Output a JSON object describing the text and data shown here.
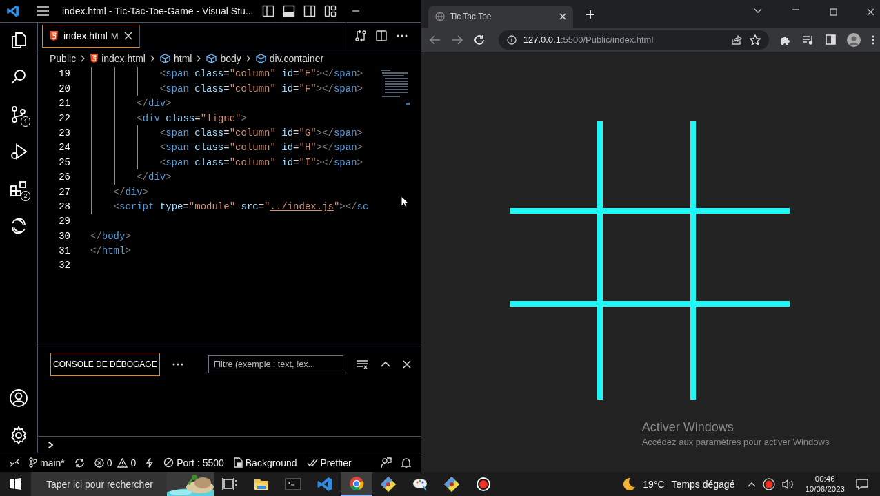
{
  "vscode": {
    "title": "index.html - Tic-Tac-Toe-Game - Visual Stu...",
    "activity_bar": [
      {
        "kind": "explorer"
      },
      {
        "kind": "search"
      },
      {
        "kind": "source-control",
        "badge": "1"
      },
      {
        "kind": "run-debug"
      },
      {
        "kind": "extensions",
        "badge": "2"
      },
      {
        "kind": "assistant"
      }
    ],
    "activity_bottom": [
      {
        "kind": "account"
      },
      {
        "kind": "settings"
      }
    ],
    "editor_tab": {
      "label": "index.html",
      "status": "M"
    },
    "breadcrumb": [
      {
        "kind": "folder",
        "label": "Public"
      },
      {
        "kind": "file",
        "label": "index.html"
      },
      {
        "kind": "element",
        "label": "html"
      },
      {
        "kind": "element",
        "label": "body"
      },
      {
        "kind": "element",
        "label": "div.container"
      }
    ],
    "code_lines": [
      {
        "number": "19",
        "tokens": [
          {
            "kind": "bracket",
            "text": "            <"
          },
          {
            "kind": "tag",
            "text": "span"
          },
          {
            "kind": "attr",
            "text": " class"
          },
          {
            "kind": "plain",
            "text": "="
          },
          {
            "kind": "string",
            "text": "\"column\""
          },
          {
            "kind": "attr",
            "text": " id"
          },
          {
            "kind": "plain",
            "text": "="
          },
          {
            "kind": "string",
            "text": "\"E\""
          },
          {
            "kind": "bracket",
            "text": "></"
          },
          {
            "kind": "tag",
            "text": "span"
          },
          {
            "kind": "bracket",
            "text": ">"
          }
        ]
      },
      {
        "number": "20",
        "tokens": [
          {
            "kind": "bracket",
            "text": "            <"
          },
          {
            "kind": "tag",
            "text": "span"
          },
          {
            "kind": "attr",
            "text": " class"
          },
          {
            "kind": "plain",
            "text": "="
          },
          {
            "kind": "string",
            "text": "\"column\""
          },
          {
            "kind": "attr",
            "text": " id"
          },
          {
            "kind": "plain",
            "text": "="
          },
          {
            "kind": "string",
            "text": "\"F\""
          },
          {
            "kind": "bracket",
            "text": "></"
          },
          {
            "kind": "tag",
            "text": "span"
          },
          {
            "kind": "bracket",
            "text": ">"
          }
        ]
      },
      {
        "number": "21",
        "tokens": [
          {
            "kind": "bracket",
            "text": "        </"
          },
          {
            "kind": "tag",
            "text": "div"
          },
          {
            "kind": "bracket",
            "text": ">"
          }
        ]
      },
      {
        "number": "22",
        "tokens": [
          {
            "kind": "bracket",
            "text": "        <"
          },
          {
            "kind": "tag",
            "text": "div"
          },
          {
            "kind": "attr",
            "text": " class"
          },
          {
            "kind": "plain",
            "text": "="
          },
          {
            "kind": "string",
            "text": "\"ligne\""
          },
          {
            "kind": "bracket",
            "text": ">"
          }
        ]
      },
      {
        "number": "23",
        "tokens": [
          {
            "kind": "bracket",
            "text": "            <"
          },
          {
            "kind": "tag",
            "text": "span"
          },
          {
            "kind": "attr",
            "text": " class"
          },
          {
            "kind": "plain",
            "text": "="
          },
          {
            "kind": "string",
            "text": "\"column\""
          },
          {
            "kind": "attr",
            "text": " id"
          },
          {
            "kind": "plain",
            "text": "="
          },
          {
            "kind": "string",
            "text": "\"G\""
          },
          {
            "kind": "bracket",
            "text": "></"
          },
          {
            "kind": "tag",
            "text": "span"
          },
          {
            "kind": "bracket",
            "text": ">"
          }
        ]
      },
      {
        "number": "24",
        "tokens": [
          {
            "kind": "bracket",
            "text": "            <"
          },
          {
            "kind": "tag",
            "text": "span"
          },
          {
            "kind": "attr",
            "text": " class"
          },
          {
            "kind": "plain",
            "text": "="
          },
          {
            "kind": "string",
            "text": "\"column\""
          },
          {
            "kind": "attr",
            "text": " id"
          },
          {
            "kind": "plain",
            "text": "="
          },
          {
            "kind": "string",
            "text": "\"H\""
          },
          {
            "kind": "bracket",
            "text": "></"
          },
          {
            "kind": "tag",
            "text": "span"
          },
          {
            "kind": "bracket",
            "text": ">"
          }
        ]
      },
      {
        "number": "25",
        "tokens": [
          {
            "kind": "bracket",
            "text": "            <"
          },
          {
            "kind": "tag",
            "text": "span"
          },
          {
            "kind": "attr",
            "text": " class"
          },
          {
            "kind": "plain",
            "text": "="
          },
          {
            "kind": "string",
            "text": "\"column\""
          },
          {
            "kind": "attr",
            "text": " id"
          },
          {
            "kind": "plain",
            "text": "="
          },
          {
            "kind": "string",
            "text": "\"I\""
          },
          {
            "kind": "bracket",
            "text": "></"
          },
          {
            "kind": "tag",
            "text": "span"
          },
          {
            "kind": "bracket",
            "text": ">"
          }
        ]
      },
      {
        "number": "26",
        "tokens": [
          {
            "kind": "bracket",
            "text": "        </"
          },
          {
            "kind": "tag",
            "text": "div"
          },
          {
            "kind": "bracket",
            "text": ">"
          }
        ]
      },
      {
        "number": "27",
        "tokens": [
          {
            "kind": "bracket",
            "text": "    </"
          },
          {
            "kind": "tag",
            "text": "div"
          },
          {
            "kind": "bracket",
            "text": ">"
          }
        ]
      },
      {
        "number": "28",
        "tokens": [
          {
            "kind": "bracket",
            "text": "    <"
          },
          {
            "kind": "tag",
            "text": "script"
          },
          {
            "kind": "attr",
            "text": " type"
          },
          {
            "kind": "plain",
            "text": "="
          },
          {
            "kind": "string",
            "text": "\"module\""
          },
          {
            "kind": "attr",
            "text": " src"
          },
          {
            "kind": "plain",
            "text": "="
          },
          {
            "kind": "string",
            "text": "\""
          },
          {
            "kind": "link",
            "text": "../index.js"
          },
          {
            "kind": "string",
            "text": "\""
          },
          {
            "kind": "bracket",
            "text": "></"
          },
          {
            "kind": "tag",
            "text": "sc"
          }
        ]
      },
      {
        "number": "29"
      },
      {
        "number": "30",
        "tokens": [
          {
            "kind": "bracket",
            "text": "</"
          },
          {
            "kind": "tag",
            "text": "body"
          },
          {
            "kind": "bracket",
            "text": ">"
          }
        ]
      },
      {
        "number": "31",
        "tokens": [
          {
            "kind": "bracket",
            "text": "</"
          },
          {
            "kind": "tag",
            "text": "html"
          },
          {
            "kind": "bracket",
            "text": ">"
          }
        ]
      },
      {
        "number": "32"
      }
    ],
    "panel": {
      "tab": "CONSOLE DE DÉBOGAGE",
      "filter_placeholder": "Filtre (exemple : text, !ex..."
    },
    "status_bar": [
      {
        "kind": "remote"
      },
      {
        "kind": "branch",
        "label": "main*"
      },
      {
        "kind": "sync"
      },
      {
        "kind": "problems",
        "errors": "0",
        "warnings": "0"
      },
      {
        "kind": "bolt"
      },
      {
        "kind": "port",
        "label": "Port : 5500"
      },
      {
        "kind": "background",
        "label": "Background"
      },
      {
        "kind": "prettier",
        "label": "Prettier"
      },
      {
        "kind": "feedback"
      },
      {
        "kind": "bell"
      }
    ]
  },
  "browser": {
    "tab_title": "Tic Tac Toe",
    "url_host": "127.0.0.1",
    "url_rest": ":5500/Public/index.html",
    "activation_notice": {
      "title": "Activer Windows",
      "text": "Accédez aux paramètres pour activer Windows"
    }
  },
  "taskbar": {
    "search_placeholder": "Taper ici pour rechercher",
    "apps": [
      {
        "kind": "task-view",
        "selected": false
      },
      {
        "kind": "explorer",
        "selected": false
      },
      {
        "kind": "terminal",
        "selected": false
      },
      {
        "kind": "vscode",
        "selected": false
      },
      {
        "kind": "chrome",
        "selected": true
      },
      {
        "kind": "git",
        "selected": false
      },
      {
        "kind": "paint",
        "selected": false
      },
      {
        "kind": "git",
        "selected": false
      },
      {
        "kind": "recorder",
        "selected": false
      }
    ],
    "weather": {
      "temp": "19°C",
      "text": "Temps dégagé"
    },
    "time": "00:46",
    "date": "10/06/2023"
  }
}
